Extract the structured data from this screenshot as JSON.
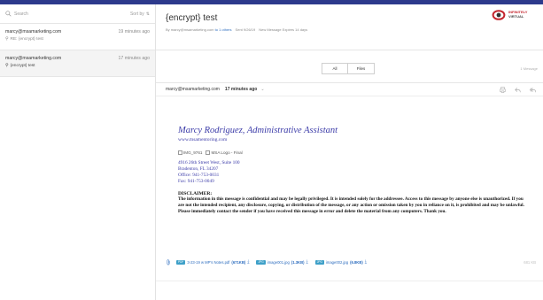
{
  "search": {
    "placeholder": "Search",
    "sort_label": "Sort by"
  },
  "mail_list": [
    {
      "from": "marcy@msamarketing.com",
      "time": "19 minutes ago",
      "subject": "RE: {encrypt} test"
    },
    {
      "from": "marcy@msamarketing.com",
      "time": "17 minutes ago",
      "subject": "{encrypt} test"
    }
  ],
  "message": {
    "subject": "{encrypt} test",
    "meta": {
      "by": "By marcy@msamarketing.com",
      "to": "to 1 others",
      "sent": "Sent 9/26/19",
      "expires": "New Message Expires 14 days"
    },
    "tabs": [
      "All",
      "Files"
    ],
    "message_count": "1 Message",
    "from": "marcy@msamarketing.com",
    "time": "17 minutes ago"
  },
  "logo": {
    "line1": "INFINITELY",
    "line2": "VIRTUAL",
    "red": "#c4262e"
  },
  "signature": {
    "name": "Marcy Rodriguez, Administrative Assistant",
    "website": "www.msamentoring.com",
    "image1": "IMG_9761",
    "image2": "MSA Logo - Final",
    "address": [
      "4916 26th Street West, Suite 100",
      "Bradenton, FL 34207",
      "Office: 941-753-0031",
      "Fax: 941-753-0049"
    ],
    "disclaimer_title": "DISCLAIMER:",
    "disclaimer": "The information in this message is confidential and may be legally privileged. It is intended solely for the addressee. Access to this message by anyone else is unauthorized. If you are not the intended recipient, any disclosure, copying, or distribution of the message, or any action or omission taken by you in reliance on it, is prohibited and may be unlawful. Please immediately contact the sender if you have received this message in error and delete the material from any computers. Thank you."
  },
  "attachments": [
    {
      "type": "PDF",
      "name": "3-23-19 w MP's Notes.pdf",
      "size": "(671KB)"
    },
    {
      "type": "JPG",
      "name": "image001.jpg",
      "size": "(1.3KB)"
    },
    {
      "type": "JPG",
      "name": "image002.jpg",
      "size": "(6.8KB)"
    }
  ],
  "attachments_total": "681 KB",
  "colors": {
    "topbar": "#2d3a8c",
    "link": "#2d6dbf",
    "signature": "#3b3ba8",
    "badge": "#3ea0c8"
  }
}
